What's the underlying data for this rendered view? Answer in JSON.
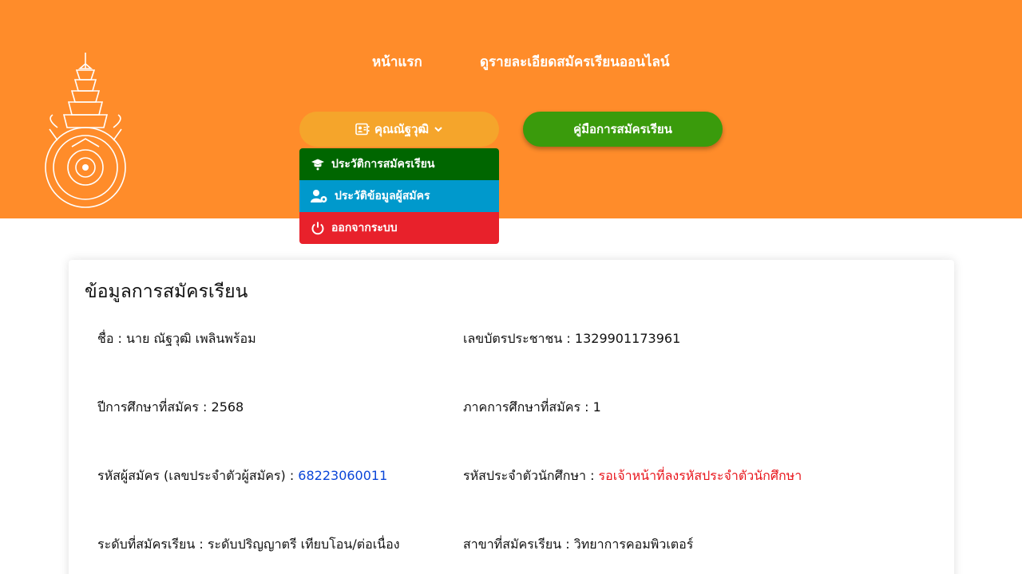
{
  "header": {
    "nav": {
      "home": "หน้าแรก",
      "details": "ดูรายละเอียดสมัครเรียนออนไลน์"
    },
    "user_button": "คุณณัฐวุฒิ",
    "manual_button": "คู่มือการสมัครเรียน",
    "dropdown": {
      "history": "ประวัติการสมัครเรียน",
      "profile": "ประวัติข้อมูลผู้สมัคร",
      "logout": "ออกจากระบบ"
    }
  },
  "card": {
    "title": "ข้อมูลการสมัครเรียน",
    "fields": {
      "name_label": "ชื่อ : ",
      "name_value": "นาย ณัฐวุฒิ เพลินพร้อม",
      "id_label": "เลขบัตรประชาชน : ",
      "id_value": "1329901173961",
      "year_label": "ปีการศึกษาที่สมัคร : ",
      "year_value": "2568",
      "semester_label": "ภาคการศึกษาที่สมัคร : ",
      "semester_value": "1",
      "applicant_label": "รหัสผู้สมัคร (เลขประจำตัวผู้สมัคร) : ",
      "applicant_value": "68223060011",
      "student_label": "รหัสประจำตัวนักศึกษา : ",
      "student_value": "รอเจ้าหน้าที่ลงรหัสประจำตัวนักศึกษา",
      "level_label": "ระดับที่สมัครเรียน : ",
      "level_value": "ระดับปริญญาตรี เทียบโอน/ต่อเนื่อง",
      "major_label": "สาขาที่สมัครเรียน : ",
      "major_value": "วิทยาการคอมพิวเตอร์"
    }
  },
  "colors": {
    "header_bg": "#ff8c2a",
    "user_btn": "#f5a52b",
    "manual_btn": "#3a9b0c",
    "dd_history": "#006600",
    "dd_profile": "#0099cc",
    "dd_logout": "#e8212b",
    "link_blue": "#0a46d8",
    "alert_red": "#e8151b"
  },
  "icons": [
    "university-emblem-icon",
    "id-card-icon",
    "chevron-down-icon",
    "graduation-cap-icon",
    "user-gear-icon",
    "power-icon"
  ]
}
